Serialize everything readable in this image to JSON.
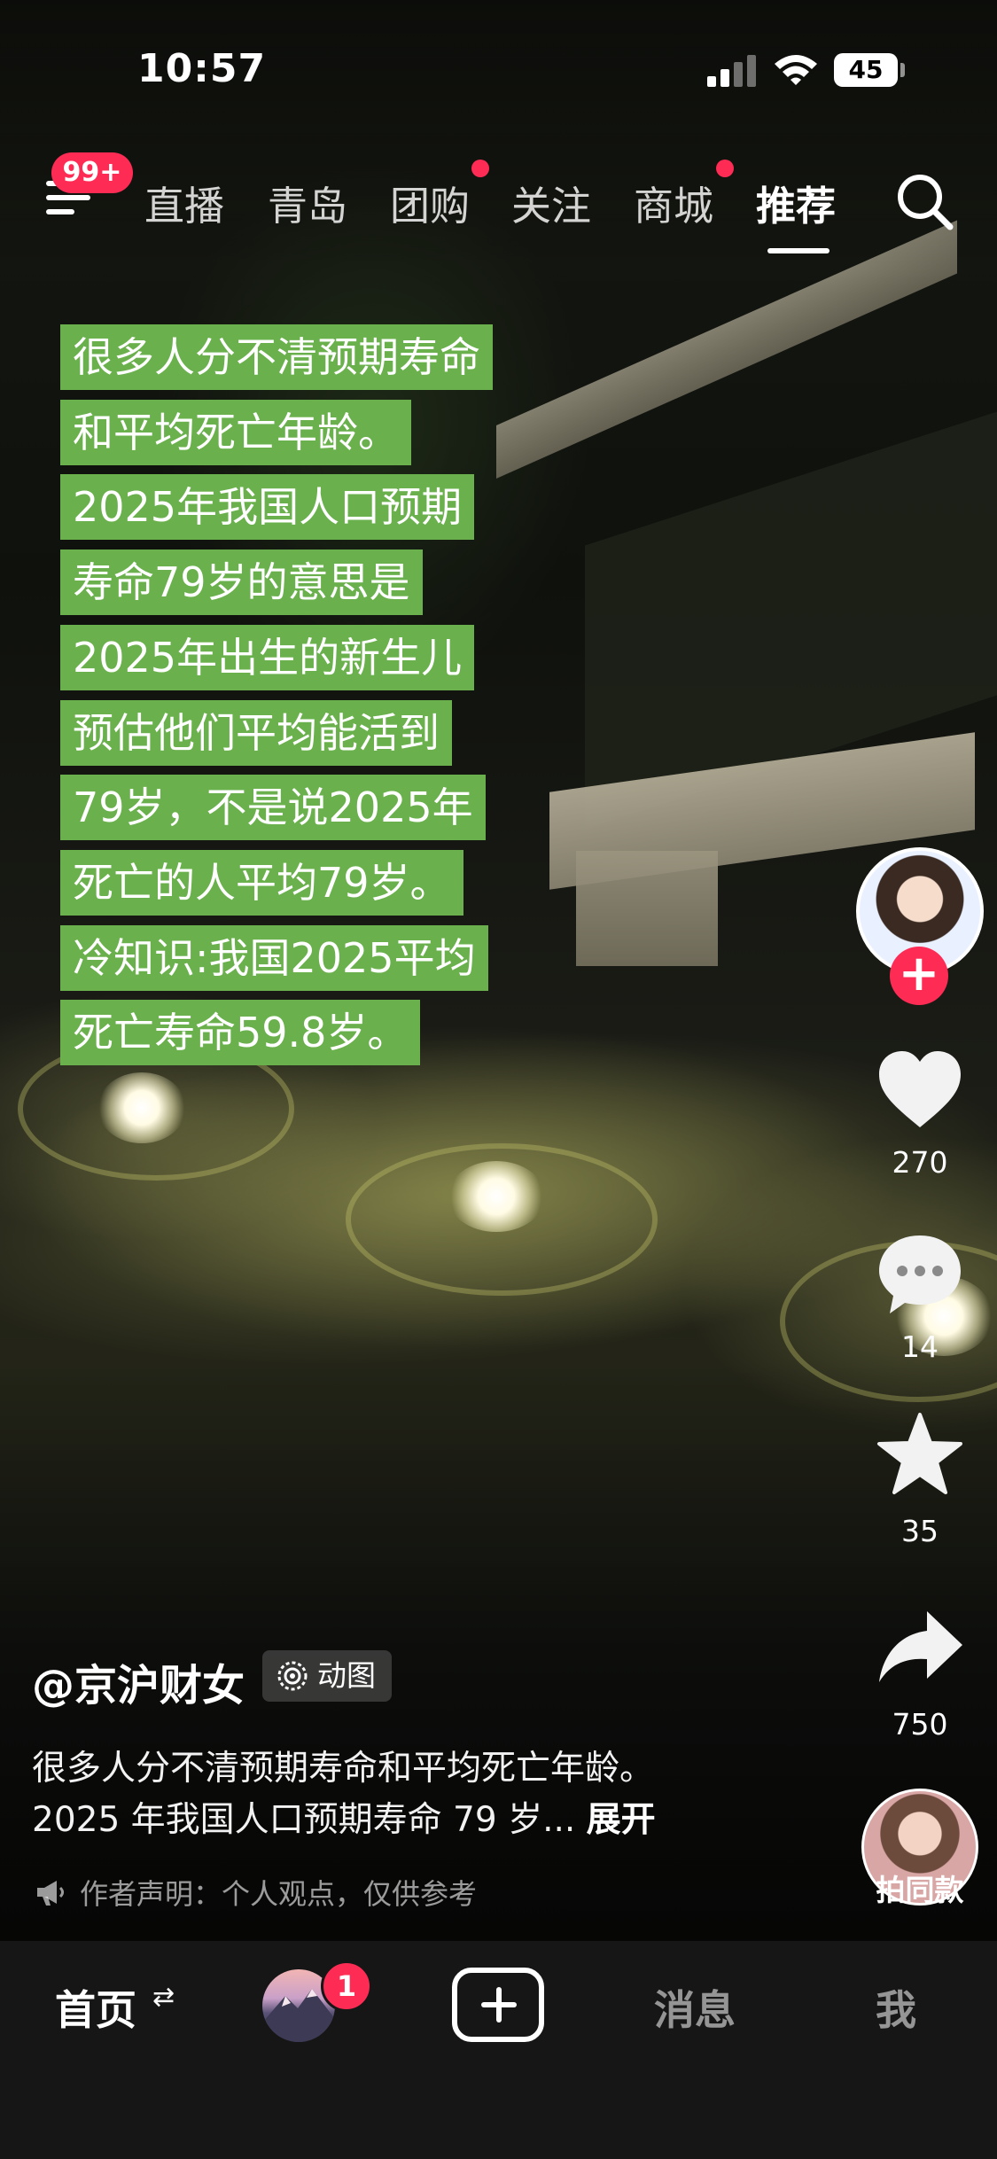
{
  "status_bar": {
    "time": "10:57",
    "battery": "45"
  },
  "top_nav": {
    "menu_badge": "99+",
    "tabs": [
      {
        "label": "直播",
        "dot": false
      },
      {
        "label": "青岛",
        "dot": false
      },
      {
        "label": "团购",
        "dot": true
      },
      {
        "label": "关注",
        "dot": false
      },
      {
        "label": "商城",
        "dot": true
      },
      {
        "label": "推荐",
        "dot": false,
        "active": true
      }
    ]
  },
  "overlay_caption": [
    "很多人分不清预期寿命",
    "和平均死亡年龄。",
    "2025年我国人口预期",
    "寿命79岁的意思是",
    "2025年出生的新生儿",
    "预估他们平均能活到",
    "79岁，不是说2025年",
    "死亡的人平均79岁。",
    "冷知识:我国2025平均",
    "死亡寿命59.8岁。"
  ],
  "actions": {
    "like_count": "270",
    "comment_count": "14",
    "favorite_count": "35",
    "share_count": "750",
    "remix_label": "拍同款"
  },
  "post": {
    "author": "@京沪财女",
    "tag": "动图",
    "description_line1": "很多人分不清预期寿命和平均死亡年龄。",
    "description_line2": "2025 年我国人口预期寿命 79 岁...",
    "expand": "展开",
    "disclaimer": "作者声明：个人观点，仅供参考"
  },
  "bottom_nav": {
    "home": "首页",
    "home_swap": "⇄",
    "friends_badge": "1",
    "messages": "消息",
    "me": "我"
  },
  "colors": {
    "accent": "#fe2c55",
    "caption_bg": "#6ab04c"
  }
}
